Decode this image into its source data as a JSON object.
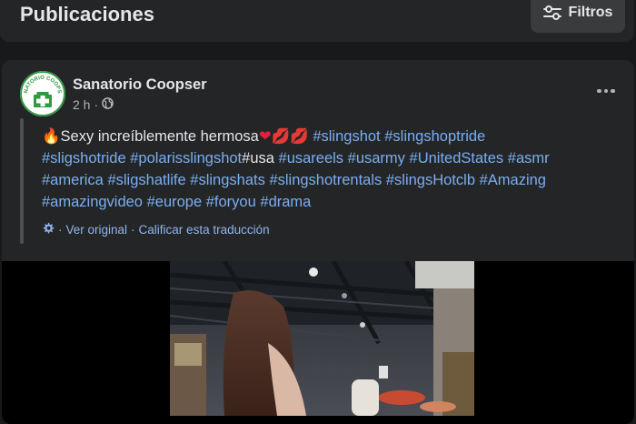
{
  "header": {
    "title": "Publicaciones",
    "filters_label": "Filtros",
    "filters_icon": "sliders-icon"
  },
  "post": {
    "author": "Sanatorio Coopser",
    "avatar_text": "SANATORIO COOPSER",
    "time": "2 h",
    "privacy_icon": "globe-icon",
    "more_icon": "more-horizontal-icon",
    "text": {
      "intro": "Sexy increíblemente hermosa",
      "tags_line1": [
        "#slingshot",
        "#slingshoptride"
      ],
      "line2_tag1": "#sligshotride",
      "line2_tag2": "#polarisslingshot",
      "line2_plain": "#usa",
      "line2_tags": [
        "#usareels",
        "#usarmy",
        "#UnitedStates",
        "#asmr"
      ],
      "line3_tags": [
        "#america",
        "#sligshatlife",
        "#slingshats",
        "#slingshotrentals",
        "#slingsHotclb",
        "#Amazing"
      ],
      "line4_tags": [
        "#amazingvideo",
        "#europe",
        "#foryou",
        "#drama"
      ]
    },
    "translation": {
      "icon": "gear-icon",
      "see_original": "Ver original",
      "separator": "·",
      "rate": "Calificar esta traducción"
    }
  },
  "colors": {
    "background": "#18191a",
    "card": "#242526",
    "hashtag": "#7aaef2",
    "text": "#e4e6eb",
    "secondary_text": "#b0b3b8",
    "avatar_green": "#2e9b3f"
  }
}
